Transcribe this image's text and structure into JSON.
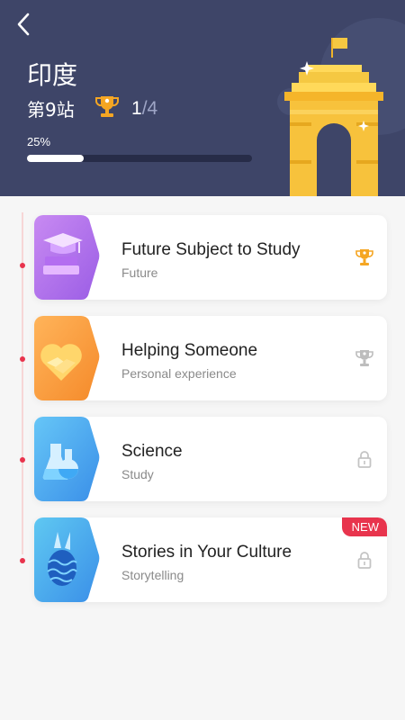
{
  "header": {
    "title": "印度",
    "station": "第9站",
    "completed": "1",
    "total": "/4",
    "percent_label": "25%",
    "percent_value": 0.25
  },
  "colors": {
    "header_bg": "#3e4568",
    "accent_red": "#e8344d",
    "gold": "#f5a623"
  },
  "lessons": [
    {
      "title": "Future Subject to Study",
      "subtitle": "Future",
      "status": "gold-trophy-icon",
      "icon": "graduation-cap-icon"
    },
    {
      "title": "Helping Someone",
      "subtitle": "Personal experience",
      "status": "silver-trophy-icon",
      "icon": "handshake-icon"
    },
    {
      "title": "Science",
      "subtitle": "Study",
      "status": "lock-icon",
      "icon": "flask-icon"
    },
    {
      "title": "Stories in Your Culture",
      "subtitle": "Storytelling",
      "status": "lock-icon",
      "icon": "easter-egg-icon",
      "badge": "NEW"
    }
  ]
}
